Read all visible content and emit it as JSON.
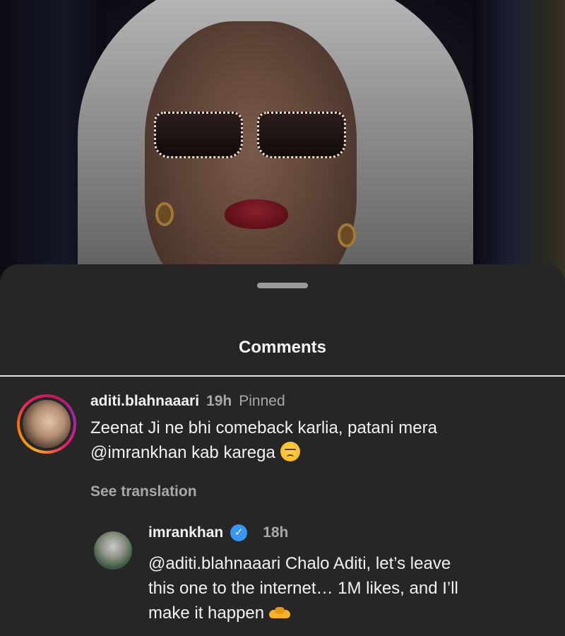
{
  "sheet": {
    "title": "Comments"
  },
  "comments": [
    {
      "username": "aditi.blahnaaari",
      "time": "19h",
      "pinned_label": "Pinned",
      "text_line1": "Zeenat Ji ne bhi comeback karlia, patani mera",
      "text_line2": "@imrankhan kab karega",
      "emoji": "disappointed-face",
      "see_translation": "See translation",
      "avatar_ring_colors": [
        "#f9a825",
        "#e91e63",
        "#9c27b0"
      ]
    },
    {
      "username": "imrankhan",
      "verified": true,
      "verified_glyph": "✓",
      "time": "18h",
      "text_line1": "@aditi.blahnaaari Chalo Aditi, let’s leave",
      "text_line2": "this one to the internet… 1M likes, and I’ll",
      "text_line3": "make it happen",
      "emoji": "handshake"
    }
  ],
  "colors": {
    "sheet_bg": "#262626",
    "text_primary": "#f2f2f2",
    "text_secondary": "#a8a8a8",
    "verified_blue": "#3897f0"
  }
}
